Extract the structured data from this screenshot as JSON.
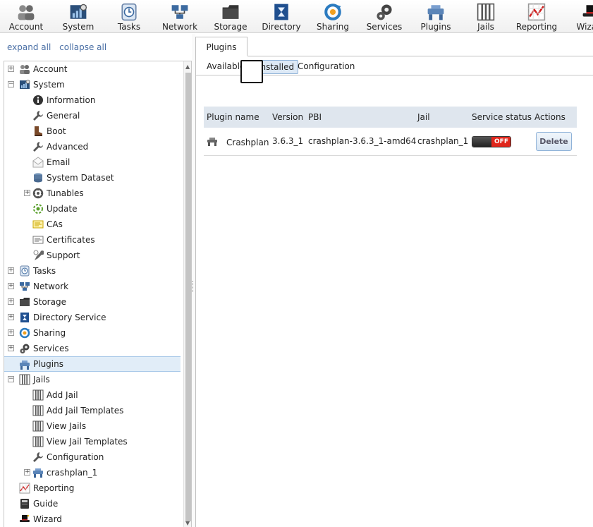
{
  "toolbar": [
    {
      "label": "Account",
      "icon": "account-icon"
    },
    {
      "label": "System",
      "icon": "system-icon"
    },
    {
      "label": "Tasks",
      "icon": "tasks-icon"
    },
    {
      "label": "Network",
      "icon": "network-icon"
    },
    {
      "label": "Storage",
      "icon": "storage-icon"
    },
    {
      "label": "Directory",
      "icon": "directory-icon"
    },
    {
      "label": "Sharing",
      "icon": "sharing-icon"
    },
    {
      "label": "Services",
      "icon": "services-icon"
    },
    {
      "label": "Plugins",
      "icon": "plugins-icon"
    },
    {
      "label": "Jails",
      "icon": "jails-icon"
    },
    {
      "label": "Reporting",
      "icon": "reporting-icon"
    },
    {
      "label": "Wizard",
      "icon": "wizard-icon"
    }
  ],
  "left": {
    "expand_all": "expand all",
    "collapse_all": "collapse all"
  },
  "tree": [
    {
      "label": "Account",
      "icon": "account-icon",
      "expander": "+"
    },
    {
      "label": "System",
      "icon": "system-icon",
      "expander": "−"
    },
    {
      "label": "Information",
      "icon": "information-icon"
    },
    {
      "label": "General",
      "icon": "wrench-icon"
    },
    {
      "label": "Boot",
      "icon": "boot-icon"
    },
    {
      "label": "Advanced",
      "icon": "wrench-icon"
    },
    {
      "label": "Email",
      "icon": "email-icon"
    },
    {
      "label": "System Dataset",
      "icon": "dataset-icon"
    },
    {
      "label": "Tunables",
      "icon": "tunables-icon",
      "expander": "+"
    },
    {
      "label": "Update",
      "icon": "update-icon"
    },
    {
      "label": "CAs",
      "icon": "certificate-authority-icon"
    },
    {
      "label": "Certificates",
      "icon": "certificate-icon"
    },
    {
      "label": "Support",
      "icon": "support-icon"
    },
    {
      "label": "Tasks",
      "icon": "tasks-icon",
      "expander": "+"
    },
    {
      "label": "Network",
      "icon": "network-icon",
      "expander": "+"
    },
    {
      "label": "Storage",
      "icon": "storage-icon",
      "expander": "+"
    },
    {
      "label": "Directory Service",
      "icon": "directory-icon",
      "expander": "+"
    },
    {
      "label": "Sharing",
      "icon": "sharing-icon",
      "expander": "+"
    },
    {
      "label": "Services",
      "icon": "services-icon",
      "expander": "+"
    },
    {
      "label": "Plugins",
      "icon": "plugins-icon",
      "selected": true
    },
    {
      "label": "Jails",
      "icon": "jails-icon",
      "expander": "−"
    },
    {
      "label": "Add Jail",
      "icon": "jails-icon"
    },
    {
      "label": "Add Jail Templates",
      "icon": "jails-icon"
    },
    {
      "label": "View Jails",
      "icon": "jails-icon"
    },
    {
      "label": "View Jail Templates",
      "icon": "jails-icon"
    },
    {
      "label": "Configuration",
      "icon": "wrench-icon"
    },
    {
      "label": "crashplan_1",
      "icon": "plugins-icon",
      "expander": "+"
    },
    {
      "label": "Reporting",
      "icon": "reporting-icon"
    },
    {
      "label": "Guide",
      "icon": "guide-icon"
    },
    {
      "label": "Wizard",
      "icon": "wizard-icon"
    }
  ],
  "main": {
    "tab_label": "Plugins",
    "subtabs": [
      {
        "label": "Available"
      },
      {
        "label": "Installed",
        "active": true
      },
      {
        "label": "Configuration"
      }
    ],
    "grid": {
      "columns": [
        "Plugin name",
        "Version",
        "PBI",
        "Jail",
        "Service status",
        "Actions"
      ],
      "rows": [
        {
          "name": "Crashplan",
          "version": "3.6.3_1",
          "pbi": "crashplan-3.6.3_1-amd64",
          "jail": "crashplan_1",
          "status": "OFF",
          "action": "Delete"
        }
      ]
    }
  }
}
